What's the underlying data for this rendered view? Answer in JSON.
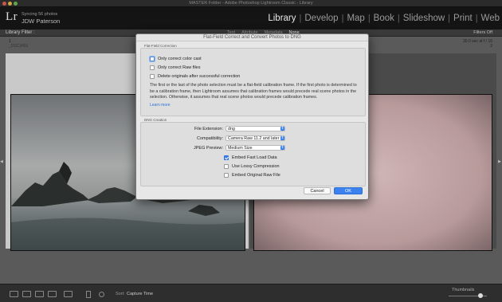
{
  "window": {
    "title": "MASTER Folder - Adobe Photoshop Lightroom Classic - Library"
  },
  "identity": {
    "logo": "Lr",
    "sync_status": "Syncing 56 photos",
    "name": "JDW Paterson"
  },
  "modules": [
    "Library",
    "Develop",
    "Map",
    "Book",
    "Slideshow",
    "Print",
    "Web"
  ],
  "active_module": "Library",
  "filter_bar": {
    "label": "Library Filter :",
    "tabs": [
      "Text",
      "Attribute",
      "Metadata",
      "None"
    ],
    "active_tab": "None",
    "custom_filter": "Filters Off"
  },
  "grid": {
    "left_index": "1",
    "left_filename": "_DSC3491",
    "right_meta": "30.0 sec at f / 16",
    "right_index": "2"
  },
  "toolbar": {
    "sort_label": "Sort:",
    "sort_value": "Capture Time",
    "thumbnails_label": "Thumbnails",
    "thumbnail_size": 0.8
  },
  "dialog": {
    "title": "Flat-Field Correct and Convert Photos to DNG",
    "correction_group_label": "Flat-Field Correction",
    "options": [
      {
        "label": "Only correct color cast",
        "checked": false
      },
      {
        "label": "Only correct Raw files",
        "checked": false
      },
      {
        "label": "Delete originals after successful correction",
        "checked": false
      }
    ],
    "info_text": "The first or the last of the photo selection must be a flat-field calibration frame. If the first photo is determined to be a calibration frame, then Lightroom assumes that calibration frames would precede real scene photos in the selection. Otherwise, it assumes that real scene photos would precede calibration frames.",
    "learn_more": "Learn more",
    "dng_group_label": "DNG Creation",
    "file_extension_label": "File Extension:",
    "file_extension_value": "dng",
    "compatibility_label": "Compatibility:",
    "compatibility_value": "Camera Raw 11.2 and later",
    "jpeg_preview_label": "JPEG Preview:",
    "jpeg_preview_value": "Medium Size",
    "dng_options": [
      {
        "label": "Embed Fast Load Data",
        "checked": true
      },
      {
        "label": "Use Lossy Compression",
        "checked": false
      },
      {
        "label": "Embed Original Raw File",
        "checked": false
      }
    ],
    "cancel_label": "Cancel",
    "ok_label": "OK"
  },
  "colors": {
    "accent": "#3b82f0",
    "module_active": "#e8e8e8",
    "module_inactive": "#9a9a9a",
    "panel_background": "#5a5a5a"
  }
}
